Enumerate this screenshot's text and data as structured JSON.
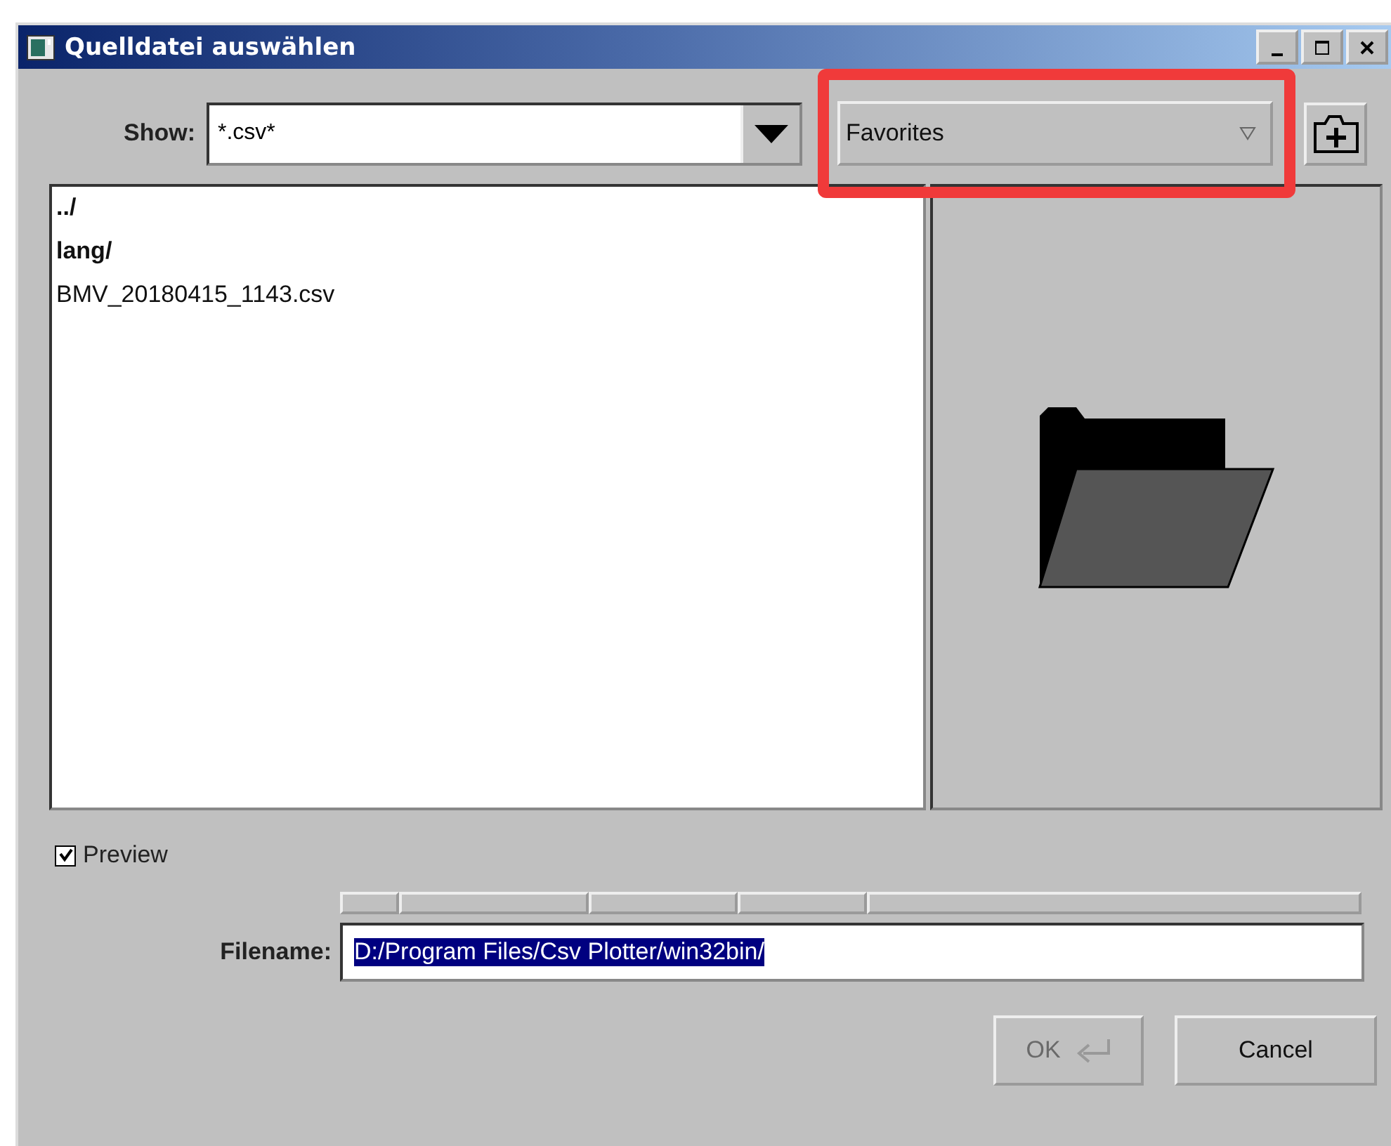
{
  "window": {
    "title": "Quelldatei auswählen"
  },
  "show": {
    "label": "Show:",
    "value": "*.csv*"
  },
  "favorites": {
    "label": "Favorites",
    "highlighted": true
  },
  "files": [
    {
      "name": "../",
      "kind": "folder"
    },
    {
      "name": "lang/",
      "kind": "folder"
    },
    {
      "name": "BMV_20180415_1143.csv",
      "kind": "file"
    }
  ],
  "preview": {
    "label": "Preview",
    "checked": true
  },
  "filename": {
    "label": "Filename:",
    "value": "D:/Program Files/Csv Plotter/win32bin/",
    "selected": true
  },
  "buttons": [
    {
      "label": "OK",
      "disabled": true,
      "kind": "ok"
    },
    {
      "label": "Cancel",
      "disabled": false,
      "kind": "cancel"
    }
  ]
}
